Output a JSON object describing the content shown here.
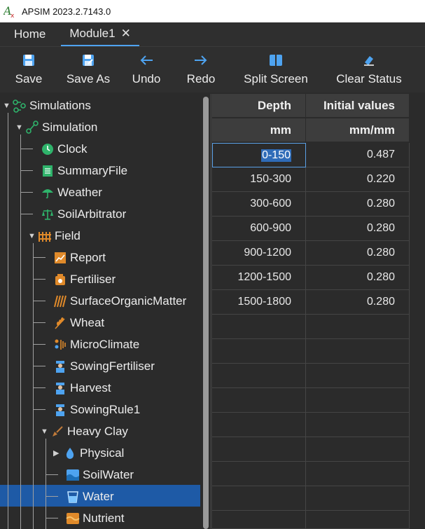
{
  "window": {
    "title": "APSIM 2023.2.7143.0"
  },
  "tabs": [
    {
      "label": "Home",
      "active": false
    },
    {
      "label": "Module1",
      "active": true
    }
  ],
  "toolbar": {
    "save": "Save",
    "save_as": "Save As",
    "undo": "Undo",
    "redo": "Redo",
    "split_screen": "Split Screen",
    "clear_status": "Clear Status"
  },
  "tree": {
    "simulations": "Simulations",
    "simulation": "Simulation",
    "clock": "Clock",
    "summary": "SummaryFile",
    "weather": "Weather",
    "soil_arbitrator": "SoilArbitrator",
    "field": "Field",
    "report": "Report",
    "fertiliser": "Fertiliser",
    "surface_om": "SurfaceOrganicMatter",
    "wheat": "Wheat",
    "microclimate": "MicroClimate",
    "sowing_fertiliser": "SowingFertiliser",
    "harvest": "Harvest",
    "sowing_rule": "SowingRule1",
    "heavy_clay": "Heavy Clay",
    "physical": "Physical",
    "soilwater": "SoilWater",
    "water": "Water",
    "nutrient": "Nutrient",
    "selected": "Water"
  },
  "grid": {
    "headers": [
      "Depth",
      "Initial values"
    ],
    "units": [
      "mm",
      "mm/mm"
    ],
    "rows": [
      [
        "0-150",
        "0.487"
      ],
      [
        "150-300",
        "0.220"
      ],
      [
        "300-600",
        "0.280"
      ],
      [
        "600-900",
        "0.280"
      ],
      [
        "900-1200",
        "0.280"
      ],
      [
        "1200-1500",
        "0.280"
      ],
      [
        "1500-1800",
        "0.280"
      ]
    ]
  },
  "colors": {
    "accent": "#4ea3f0",
    "selection": "#1e5aa6",
    "icon_green": "#2fb36b",
    "icon_orange": "#e08a2a"
  }
}
